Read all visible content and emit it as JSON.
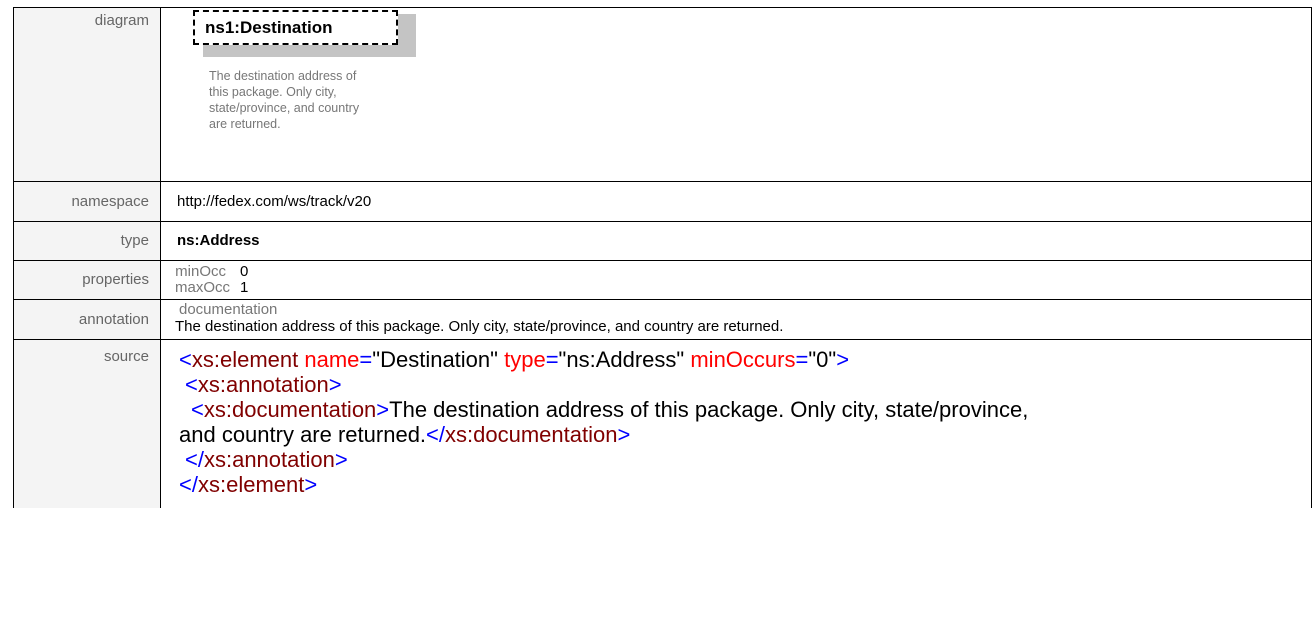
{
  "rows": {
    "diagram": {
      "label": "diagram",
      "element_prefix": "ns1:",
      "element_name": "Destination",
      "doc_lines": [
        "The destination address of",
        "this package. Only city,",
        "state/province, and country",
        "are returned."
      ]
    },
    "namespace": {
      "label": "namespace",
      "value": "http://fedex.com/ws/track/v20"
    },
    "type": {
      "label": "type",
      "value": "ns:Address"
    },
    "properties": {
      "label": "properties",
      "items": [
        {
          "key": "minOcc",
          "value": "0"
        },
        {
          "key": "maxOcc",
          "value": "1"
        }
      ]
    },
    "annotation": {
      "label": "annotation",
      "heading": "documentation",
      "text": "The destination address of this package. Only city, state/province, and country are returned."
    },
    "source": {
      "label": "source",
      "element_open": {
        "lt": "<",
        "name": "xs:element",
        "attr1": "name",
        "val1": "\"Destination\"",
        "attr2": "type",
        "val2": "\"ns:Address\"",
        "attr3": "minOccurs",
        "val3": "\"0\"",
        "gt": ">"
      },
      "annotation_open": {
        "lt": "<",
        "name": "xs:annotation",
        "gt": ">"
      },
      "documentation_open": {
        "lt": "<",
        "name": "xs:documentation",
        "gt": ">"
      },
      "doc_text_1": "The destination address of this package. Only city, state/province,",
      "doc_text_2": "and country are returned.",
      "documentation_close": {
        "lt": "</",
        "name": "xs:documentation",
        "gt": ">"
      },
      "annotation_close": {
        "lt": "</",
        "name": "xs:annotation",
        "gt": ">"
      },
      "element_close": {
        "lt": "</",
        "name": "xs:element",
        "gt": ">"
      },
      "eq": "="
    }
  }
}
